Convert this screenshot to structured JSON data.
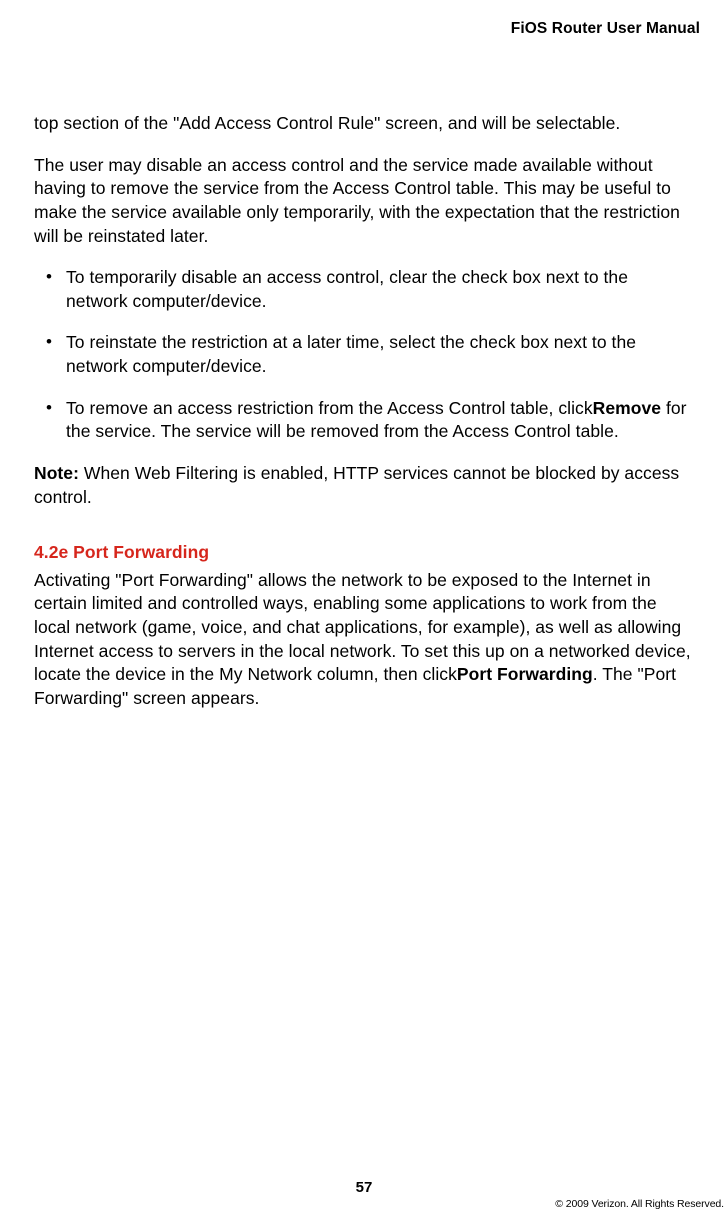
{
  "header": {
    "title": "FiOS Router User Manual"
  },
  "body": {
    "para1": "top section of the \"Add Access Control Rule\" screen, and will be selectable.",
    "para2": "The user may disable an access control and the service made available without having to remove the service from the Access Control table. This may be useful to make the service available only temporarily, with the expectation that the restriction will be reinstated later.",
    "bullets": [
      {
        "text": "To temporarily disable an access control, clear the check box next to the network computer/device."
      },
      {
        "text": "To reinstate the restriction at a later time, select the check box next to the network computer/device."
      },
      {
        "text_pre": "To remove an access restriction from the Access Control table, click",
        "bold": "Remove",
        "text_post": " for the service. The service will be removed from the Access Control table."
      }
    ],
    "note_label": "Note:",
    "note_text": " When Web Filtering is enabled, HTTP services cannot be blocked by access control.",
    "section_heading": "4.2e  Port Forwarding",
    "section_para_pre": "Activating \"Port Forwarding\" allows the network to be exposed to the Internet in certain limited and controlled ways, enabling some applications to work from the local network (game, voice, and chat applications, for example), as well as allowing Internet access to servers in the local network. To set this up on a networked device, locate the device in the My Network column, then click",
    "section_para_bold": "Port Forwarding",
    "section_para_post": ". The \"Port Forwarding\" screen appears."
  },
  "footer": {
    "page_number": "57",
    "copyright": "© 2009 Verizon. All Rights Reserved."
  }
}
